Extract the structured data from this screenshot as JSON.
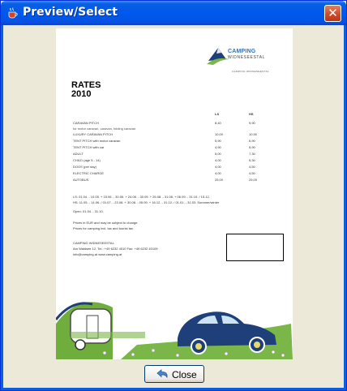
{
  "window": {
    "title": "Preview/Select",
    "close_glyph": "✕"
  },
  "icons": {
    "app": "java-cup-icon",
    "close": "close-icon",
    "button": "undo-arrow-icon"
  },
  "document": {
    "brand": {
      "name": "CAMPING",
      "subtitle": "WIDNESEESTAL"
    },
    "contact_line": "CAMPING WIDNESEESTAL",
    "title_line1": "RATES",
    "title_line2": "2010",
    "column_headers": {
      "low": "LS",
      "high": "HS"
    },
    "rows": [
      {
        "label": "CARAVAN PITCH",
        "low": "8,40",
        "high": "9,90"
      },
      {
        "label": "LUXURY CARAVAN PITCH",
        "low": "10,00",
        "high": "10,90"
      },
      {
        "label": "TENT PITCH with motor caravan",
        "low": "5,90",
        "high": "6,90"
      },
      {
        "label": "TENT PITCH with car",
        "low": "4,90",
        "high": "5,90"
      },
      {
        "label": "ADULT",
        "low": "5,00",
        "high": "7,30"
      },
      {
        "label": "CHILD (age 5 - 14)",
        "low": "4,00",
        "high": "5,30"
      },
      {
        "label": "DOGS (per day)",
        "low": "4,00",
        "high": "4,50"
      },
      {
        "label": "ELECTRIC CHARGE",
        "low": "4,00",
        "high": "4,50"
      },
      {
        "label": "AUTOBUS",
        "low": "25,00",
        "high": "25,00"
      }
    ],
    "row_subtext": "for motor caravan, caravan, folding caravan",
    "notes": [
      "LS: 01.04. - 10.05. + 15.06. - 30.06. + 24.08. - 30.09. + 26.08. - 31.08. + 06.09. - 31.10. / 15.12.",
      "HS: 11.05. - 14.06. / 01.07. - 23.08. + 30.08. - 05.09. + 16.12. - 31.12. / 01.01. - 31.03. Summer/winter",
      "Open: 01.04. - 31.10.",
      "Prices in EUR and may be subject to change.",
      "Prices for camping incl. tax and tourist tax.",
      "CAMPING WIDNESEESTAL",
      "Am Waldsee 12, Tel.: +49 6232 4010  Fax: +49 6232 40109",
      "info@camping.at  www.camping.at"
    ]
  },
  "buttons": {
    "close_label": "Close"
  }
}
